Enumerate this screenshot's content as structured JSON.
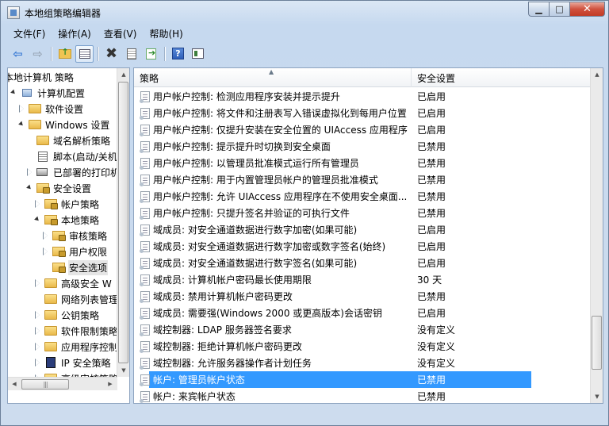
{
  "window": {
    "title": "本地组策略编辑器",
    "minimize_glyph": "▁",
    "maximize_glyph": "□",
    "close_glyph": "✕"
  },
  "menu": [
    "文件(F)",
    "操作(A)",
    "查看(V)",
    "帮助(H)"
  ],
  "toolbar": {
    "icons": [
      "back-arrow-icon",
      "forward-arrow-icon",
      "up-folder-icon",
      "show-hide-tree-icon",
      "delete-icon",
      "properties-icon",
      "export-list-icon",
      "help-icon",
      "show-hide-action-pane-icon"
    ],
    "back_glyph": "⇦",
    "forward_glyph": "⇨",
    "delete_glyph": "✖",
    "help_glyph": "?"
  },
  "tree": {
    "items": [
      {
        "label": "本地计算机 策略",
        "indent": 0,
        "toggle": "none",
        "icon": "none"
      },
      {
        "label": "计算机配置",
        "indent": 1,
        "toggle": "expanded",
        "icon": "computer"
      },
      {
        "label": "软件设置",
        "indent": 2,
        "toggle": "collapsed",
        "icon": "folder"
      },
      {
        "label": "Windows 设置",
        "indent": 2,
        "toggle": "expanded",
        "icon": "folder"
      },
      {
        "label": "域名解析策略",
        "indent": 3,
        "toggle": "none",
        "icon": "folder"
      },
      {
        "label": "脚本(启动/关机)",
        "indent": 3,
        "toggle": "none",
        "icon": "script"
      },
      {
        "label": "已部署的打印机",
        "indent": 3,
        "toggle": "collapsed",
        "icon": "printer"
      },
      {
        "label": "安全设置",
        "indent": 3,
        "toggle": "expanded",
        "icon": "lockfolder"
      },
      {
        "label": "帐户策略",
        "indent": 4,
        "toggle": "collapsed",
        "icon": "lockfolder"
      },
      {
        "label": "本地策略",
        "indent": 4,
        "toggle": "expanded",
        "icon": "lockfolder"
      },
      {
        "label": "审核策略",
        "indent": 5,
        "toggle": "collapsed",
        "icon": "lockfolder"
      },
      {
        "label": "用户权限",
        "indent": 5,
        "toggle": "collapsed",
        "icon": "lockfolder"
      },
      {
        "label": "安全选项",
        "indent": 5,
        "toggle": "none",
        "icon": "lockfolder",
        "selected": true
      },
      {
        "label": "高级安全 W",
        "indent": 4,
        "toggle": "collapsed",
        "icon": "folder"
      },
      {
        "label": "网络列表管理",
        "indent": 4,
        "toggle": "none",
        "icon": "folder"
      },
      {
        "label": "公钥策略",
        "indent": 4,
        "toggle": "collapsed",
        "icon": "folder"
      },
      {
        "label": "软件限制策略",
        "indent": 4,
        "toggle": "collapsed",
        "icon": "folder"
      },
      {
        "label": "应用程序控制",
        "indent": 4,
        "toggle": "collapsed",
        "icon": "folder"
      },
      {
        "label": "IP 安全策略",
        "indent": 4,
        "toggle": "collapsed",
        "icon": "ipsec"
      },
      {
        "label": "高级审核策略",
        "indent": 4,
        "toggle": "collapsed",
        "icon": "folder"
      }
    ],
    "hscroll_grip": "|||"
  },
  "list": {
    "columns": {
      "policy": "策略",
      "setting": "安全设置"
    },
    "sort_glyph": "▲",
    "rows": [
      {
        "policy": "用户帐户控制: 检测应用程序安装并提示提升",
        "setting": "已启用"
      },
      {
        "policy": "用户帐户控制: 将文件和注册表写入错误虚拟化到每用户位置",
        "setting": "已启用"
      },
      {
        "policy": "用户帐户控制: 仅提升安装在安全位置的 UIAccess 应用程序",
        "setting": "已启用"
      },
      {
        "policy": "用户帐户控制: 提示提升时切换到安全桌面",
        "setting": "已禁用"
      },
      {
        "policy": "用户帐户控制: 以管理员批准模式运行所有管理员",
        "setting": "已禁用"
      },
      {
        "policy": "用户帐户控制: 用于内置管理员帐户的管理员批准模式",
        "setting": "已禁用"
      },
      {
        "policy": "用户帐户控制: 允许 UIAccess 应用程序在不使用安全桌面...",
        "setting": "已禁用"
      },
      {
        "policy": "用户帐户控制: 只提升签名并验证的可执行文件",
        "setting": "已禁用"
      },
      {
        "policy": "域成员: 对安全通道数据进行数字加密(如果可能)",
        "setting": "已启用"
      },
      {
        "policy": "域成员: 对安全通道数据进行数字加密或数字签名(始终)",
        "setting": "已启用"
      },
      {
        "policy": "域成员: 对安全通道数据进行数字签名(如果可能)",
        "setting": "已启用"
      },
      {
        "policy": "域成员: 计算机帐户密码最长使用期限",
        "setting": "30 天"
      },
      {
        "policy": "域成员: 禁用计算机帐户密码更改",
        "setting": "已禁用"
      },
      {
        "policy": "域成员: 需要强(Windows 2000 或更高版本)会话密钥",
        "setting": "已启用"
      },
      {
        "policy": "域控制器: LDAP 服务器签名要求",
        "setting": "没有定义"
      },
      {
        "policy": "域控制器: 拒绝计算机帐户密码更改",
        "setting": "没有定义"
      },
      {
        "policy": "域控制器: 允许服务器操作者计划任务",
        "setting": "没有定义"
      },
      {
        "policy": "帐户: 管理员帐户状态",
        "setting": "已禁用",
        "selected": true
      },
      {
        "policy": "帐户: 来宾帐户状态",
        "setting": "已禁用"
      }
    ]
  },
  "scroll_glyphs": {
    "up": "▲",
    "down": "▼",
    "left": "◀",
    "right": "▶"
  },
  "colors": {
    "selection": "#3399ff",
    "window_frame": "#c6d9ef"
  }
}
